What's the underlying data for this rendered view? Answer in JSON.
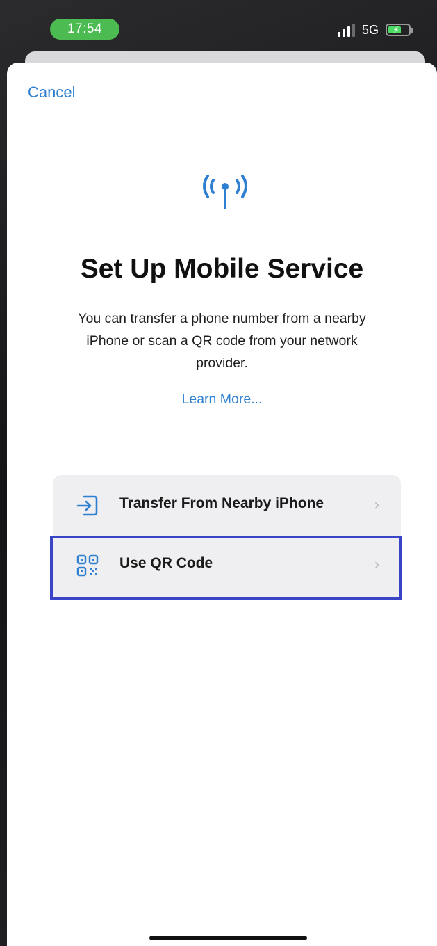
{
  "status_bar": {
    "time": "17:54",
    "network": "5G",
    "icons": {
      "signal": "cellular-signal-icon",
      "battery": "battery-charging-icon"
    }
  },
  "sheet": {
    "cancel_label": "Cancel",
    "header_icon": "antenna-radiowaves-icon",
    "title": "Set Up Mobile Service",
    "description": "You can transfer a phone number from a nearby iPhone or scan a QR code from your network provider.",
    "learn_more_label": "Learn More...",
    "options": [
      {
        "label": "Transfer From Nearby iPhone",
        "icon": "transfer-arrow-icon",
        "chevron": "›"
      },
      {
        "label": "Use QR Code",
        "icon": "qr-code-icon",
        "chevron": "›",
        "highlighted": true
      }
    ]
  },
  "colors": {
    "accent": "#2f80d1",
    "status_pill": "#4cbb52",
    "highlight_border": "#3a44c6",
    "option_background": "#efeff2"
  }
}
